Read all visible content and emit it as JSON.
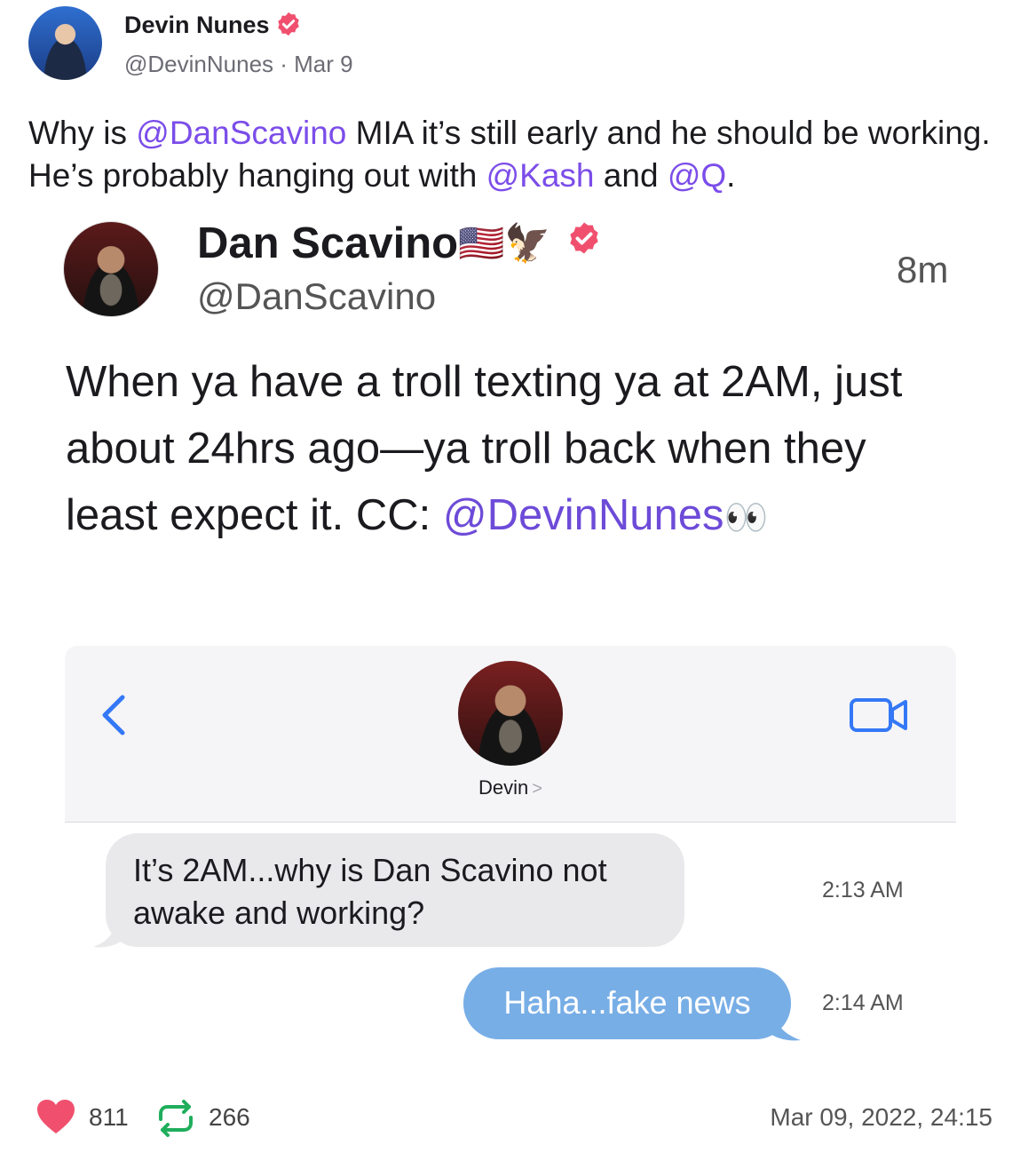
{
  "post": {
    "author_name": "Devin Nunes",
    "handle": "@DevinNunes",
    "separator": " · ",
    "date_short": "Mar 9",
    "text_parts": [
      "Why is ",
      "@DanScavino",
      " MIA it’s still early and he should be working. He’s probably hanging out with ",
      "@Kash",
      " and ",
      "@Q",
      "."
    ]
  },
  "embedded_tweet": {
    "name": "Dan Scavino",
    "name_emojis": "🇺🇸🦅",
    "handle": "@DanScavino",
    "time": "8m",
    "text": "When ya have a troll texting ya at 2AM, just about 24hrs ago—ya troll back when they least expect it. CC: ",
    "mention": "@DevinNunes",
    "trailing_emoji": "👀"
  },
  "imessage": {
    "contact_name": "Devin",
    "contact_chevron": ">",
    "incoming_text": "It’s 2AM...why is Dan Scavino not awake and working?",
    "incoming_time": "2:13 AM",
    "outgoing_text": "Haha...fake news",
    "outgoing_time": "2:14 AM"
  },
  "footer": {
    "likes": "811",
    "reposts": "266",
    "timestamp": "Mar 09, 2022, 24:15"
  },
  "colors": {
    "mention": "#7b4de9",
    "verified": "#f0506e",
    "heart": "#f0506e",
    "repost": "#1fae5c",
    "bubble_out": "#78aee6",
    "bubble_in": "#e9e9eb",
    "ios_blue": "#3478f6"
  },
  "icons": [
    "verified-badge-icon",
    "back-chevron-icon",
    "facetime-video-icon",
    "heart-icon",
    "repost-icon"
  ]
}
